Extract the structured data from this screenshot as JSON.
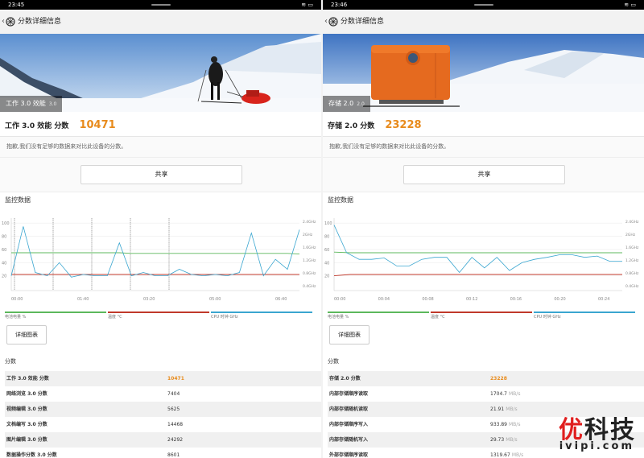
{
  "colors": {
    "accent": "#e88b1c",
    "battery": "#5cb85c",
    "temperature": "#c0392b",
    "cpu": "#3aa6d0",
    "watermark_red": "#e01f1f"
  },
  "left": {
    "status": {
      "time": "23:45",
      "icons": "≋ ▭"
    },
    "nav": {
      "back_icon": "chevron-left-icon",
      "title": "分数详细信息"
    },
    "hero": {
      "tag": "工作 3.0 效能",
      "ver": "3.0"
    },
    "score": {
      "label": "工作 3.0 效能 分数",
      "value": "10471"
    },
    "note": "抱歉,我们没有足够的数据来对比此设备的分数。",
    "share": "共享",
    "monitor_title": "监控数据",
    "chart_data": {
      "type": "line",
      "x_ticks": [
        "00:00",
        "01:40",
        "03:20",
        "05:00",
        "06:40"
      ],
      "y_left_ticks": [
        100,
        80,
        60,
        40,
        20
      ],
      "y_right_ticks": [
        "2.4GHz",
        "2GHz",
        "1.6GHz",
        "1.2GHz",
        "0.8GHz",
        "0.4GHz"
      ],
      "series": [
        {
          "name": "电池电量 %",
          "values": [
            55,
            55,
            55,
            55,
            55,
            55,
            55,
            55,
            55,
            55,
            54,
            54,
            54,
            54,
            54,
            54,
            54,
            54,
            54,
            54,
            54,
            54,
            54,
            54,
            53
          ]
        },
        {
          "name": "温度 °C",
          "values": [
            22,
            22,
            22,
            22,
            22,
            22,
            22,
            22,
            22,
            22,
            22,
            22,
            22,
            22,
            22,
            22,
            22,
            22,
            22,
            22,
            22,
            22,
            22,
            22,
            22
          ]
        },
        {
          "name": "CPU 时钟 GHz",
          "values": [
            20,
            95,
            25,
            20,
            40,
            18,
            22,
            20,
            20,
            70,
            20,
            25,
            20,
            20,
            30,
            22,
            20,
            22,
            20,
            25,
            85,
            20,
            45,
            30,
            90
          ]
        }
      ],
      "markers": 5
    },
    "legend": [
      "电池电量 %",
      "温度 °C",
      "CPU 时钟 GHz"
    ],
    "detail_button": "详细图表",
    "scores_title": "分数",
    "rows": [
      {
        "name": "工作 3.0 效能 分数",
        "value": "10471",
        "unit": ""
      },
      {
        "name": "网络浏览 3.0 分数",
        "value": "7404",
        "unit": ""
      },
      {
        "name": "视频编辑 3.0 分数",
        "value": "5625",
        "unit": ""
      },
      {
        "name": "文档编写 3.0 分数",
        "value": "14468",
        "unit": ""
      },
      {
        "name": "图片编辑 3.0 分数",
        "value": "24292",
        "unit": ""
      },
      {
        "name": "数据操作分数 3.0 分数",
        "value": "8601",
        "unit": ""
      }
    ]
  },
  "right": {
    "status": {
      "time": "23:46",
      "icons": "≋ ▭"
    },
    "nav": {
      "back_icon": "chevron-left-icon",
      "title": "分数详细信息"
    },
    "hero": {
      "tag": "存储 2.0",
      "ver": "2.0"
    },
    "score": {
      "label": "存储 2.0 分数",
      "value": "23228"
    },
    "note": "抱歉,我们没有足够的数据来对比此设备的分数。",
    "share": "共享",
    "monitor_title": "监控数据",
    "chart_data": {
      "type": "line",
      "x_ticks": [
        "00:00",
        "00:04",
        "00:08",
        "00:12",
        "00:16",
        "00:20",
        "00:24"
      ],
      "y_left_ticks": [
        100,
        80,
        60,
        40,
        20
      ],
      "y_right_ticks": [
        "2.4GHz",
        "2GHz",
        "1.6GHz",
        "1.2GHz",
        "0.8GHz",
        "0.4GHz"
      ],
      "series": [
        {
          "name": "电池电量 %",
          "values": [
            56,
            55,
            55,
            55,
            55,
            55,
            55,
            55,
            55,
            55,
            55,
            55,
            55,
            55,
            55,
            55,
            55,
            55,
            55
          ]
        },
        {
          "name": "温度 °C",
          "values": [
            20,
            22,
            22,
            22,
            22,
            22,
            22,
            22,
            22,
            22,
            22,
            22,
            22,
            22,
            22,
            22,
            22,
            22,
            22
          ]
        },
        {
          "name": "CPU 时钟 GHz",
          "values": [
            97,
            55,
            45,
            45,
            47,
            35,
            35,
            45,
            48,
            48,
            25,
            48,
            32,
            48,
            28,
            40,
            45,
            48,
            52,
            52,
            48,
            50,
            42,
            42
          ]
        }
      ],
      "markers": 0
    },
    "legend": [
      "电池电量 %",
      "温度 °C",
      "CPU 时钟 GHz"
    ],
    "detail_button": "详细图表",
    "scores_title": "分数",
    "rows": [
      {
        "name": "存储 2.0 分数",
        "value": "23228",
        "unit": ""
      },
      {
        "name": "内部存储顺序读取",
        "value": "1704.7",
        "unit": "MB/s"
      },
      {
        "name": "内部存储随机读取",
        "value": "21.91",
        "unit": "MB/s"
      },
      {
        "name": "内部存储顺序写入",
        "value": "933.89",
        "unit": "MB/s"
      },
      {
        "name": "内部存储随机写入",
        "value": "29.73",
        "unit": "MB/s"
      },
      {
        "name": "外部存储顺序读取",
        "value": "1319.67",
        "unit": "MB/s"
      }
    ]
  },
  "watermark": {
    "top_red": "优",
    "top_rest": "科技",
    "bottom": "ivipi.com"
  }
}
